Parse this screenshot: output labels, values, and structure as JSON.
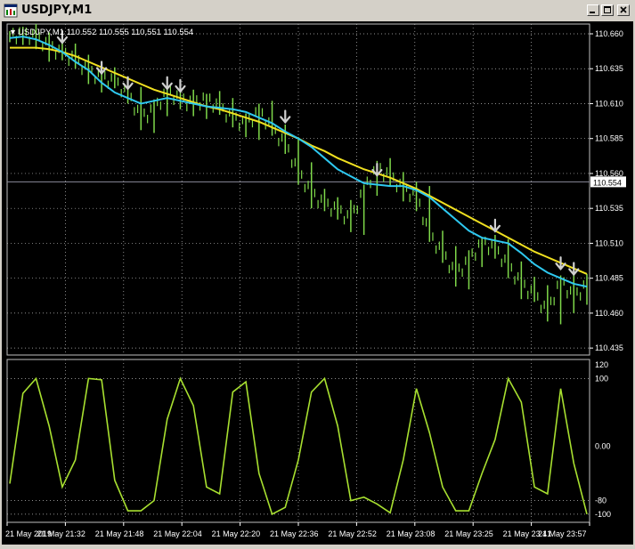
{
  "window": {
    "title": "USDJPY,M1",
    "icon": "chart-window-icon",
    "controls": [
      "minimize-icon",
      "maximize-icon",
      "close-icon"
    ]
  },
  "chart": {
    "header": "USDJPY,M1  110.552 110.555 110,551 110.554",
    "current_price": "110.554",
    "price_ticks": [
      "110.660",
      "110.635",
      "110.610",
      "110.585",
      "110.560",
      "110.535",
      "110.510",
      "110.485",
      "110.460",
      "110.435"
    ],
    "indicator_ticks": [
      "120",
      "100",
      "0.00",
      "-80",
      "-100"
    ],
    "time_ticks": [
      "21 May 2019",
      "21 May 21:32",
      "21 May 21:48",
      "21 May 22:04",
      "21 May 22:20",
      "21 May 22:36",
      "21 May 22:52",
      "21 May 23:08",
      "21 May 23:25",
      "21 May 23:41",
      "21 May 23:57"
    ],
    "colors": {
      "background": "#000000",
      "grid": "#c0c0c0",
      "candles": "#7fd94a",
      "ma_fast": "#2ec8f0",
      "ma_slow": "#f0e020",
      "oscillator": "#a8e030",
      "arrows": "#d0d0d0"
    }
  },
  "chart_data": [
    {
      "type": "line",
      "title": "USDJPY,M1",
      "ylim": [
        110.43,
        110.667
      ],
      "series": [
        {
          "values": [
            110.657,
            110.658,
            110.656,
            110.652,
            110.647,
            110.64,
            110.634,
            110.625,
            110.618,
            110.614,
            110.61,
            110.612,
            110.614,
            110.612,
            110.61,
            110.608,
            110.607,
            110.606,
            110.604,
            110.6,
            110.596,
            110.59,
            110.585,
            110.579,
            110.571,
            110.563,
            110.558,
            110.553,
            110.552,
            110.551,
            110.551,
            110.548,
            110.543,
            110.535,
            110.527,
            110.519,
            110.514,
            110.512,
            110.51,
            110.503,
            110.495,
            110.489,
            110.485,
            110.481,
            110.479
          ]
        },
        {
          "values": [
            110.65,
            110.65,
            110.65,
            110.649,
            110.647,
            110.644,
            110.64,
            110.636,
            110.632,
            110.628,
            110.624,
            110.62,
            110.617,
            110.614,
            110.611,
            110.608,
            110.606,
            110.603,
            110.6,
            110.597,
            110.593,
            110.589,
            110.585,
            110.58,
            110.576,
            110.571,
            110.567,
            110.563,
            110.56,
            110.557,
            110.553,
            110.549,
            110.544,
            110.539,
            110.534,
            110.529,
            110.524,
            110.519,
            110.514,
            110.509,
            110.504,
            110.5,
            110.496,
            110.492,
            110.488
          ]
        },
        {
          "values": [
            110.658,
            110.659,
            110.657,
            110.65,
            110.645,
            110.641,
            110.632,
            110.628,
            110.625,
            110.616,
            110.599,
            110.605,
            110.618,
            110.612,
            110.609,
            110.613,
            110.606,
            110.599,
            110.594,
            110.604,
            110.591,
            110.58,
            110.56,
            110.545,
            110.537,
            110.533,
            110.526,
            110.548,
            110.563,
            110.557,
            110.548,
            110.543,
            110.515,
            110.502,
            110.487,
            110.497,
            110.51,
            110.505,
            110.493,
            110.48,
            110.472,
            110.46,
            110.483,
            110.47,
            110.48
          ]
        }
      ]
    },
    {
      "type": "line",
      "ylim": [
        -112,
        128
      ],
      "series": [
        {
          "values": [
            -55,
            78,
            100,
            30,
            -60,
            -20,
            100,
            98,
            -50,
            -95,
            -95,
            -80,
            40,
            100,
            60,
            -60,
            -70,
            80,
            95,
            -40,
            -100,
            -90,
            -20,
            80,
            100,
            30,
            -80,
            -75,
            -85,
            -98,
            -20,
            85,
            20,
            -60,
            -95,
            -95,
            -40,
            10,
            100,
            65,
            -60,
            -70,
            85,
            -25,
            -100
          ]
        }
      ]
    }
  ]
}
